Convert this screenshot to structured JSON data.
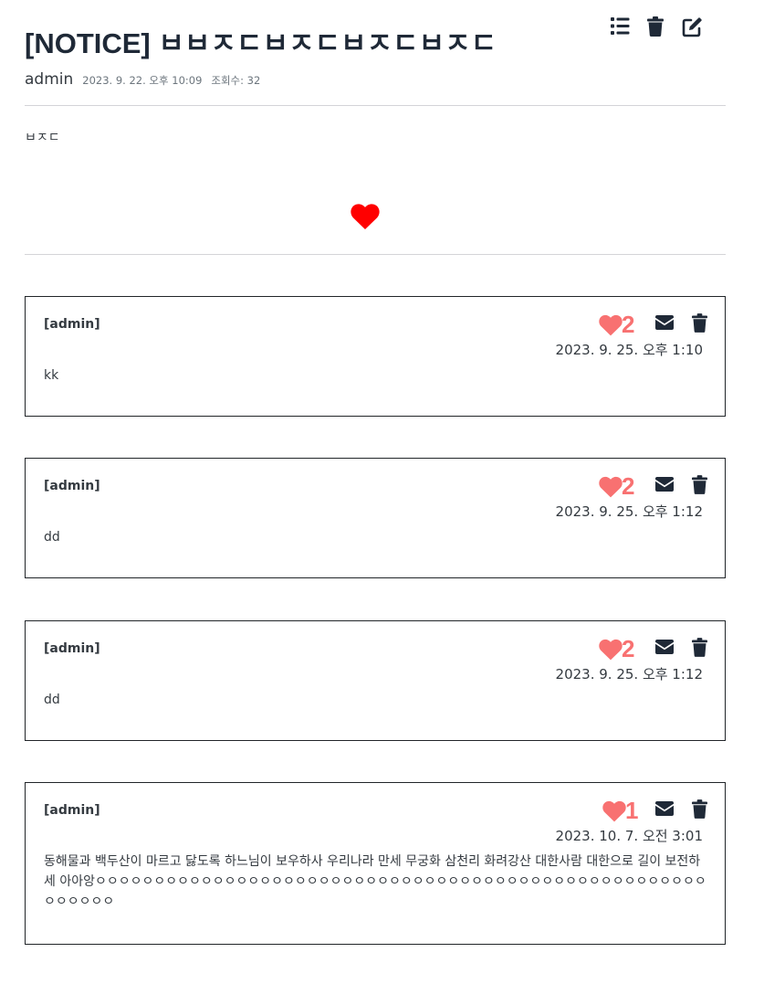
{
  "post": {
    "title": "[NOTICE] ㅂㅂㅈㄷㅂㅈㄷㅂㅈㄷㅂㅈㄷ",
    "author": "admin",
    "date": "2023. 9. 22. 오후 10:09",
    "views": "조회수: 32",
    "content": "ㅂㅈㄷ",
    "actions": [
      "list-icon",
      "trash-icon",
      "edit-icon"
    ],
    "like_icon": "heart-icon",
    "like_color": "#ff0000"
  },
  "comments": [
    {
      "author": "[admin]",
      "likes": "2",
      "date": "2023. 9. 25. 오후 1:10",
      "text": "kk"
    },
    {
      "author": "[admin]",
      "likes": "2",
      "date": "2023. 9. 25. 오후 1:12",
      "text": "dd"
    },
    {
      "author": "[admin]",
      "likes": "2",
      "date": "2023. 9. 25. 오후 1:12",
      "text": "dd"
    },
    {
      "author": "[admin]",
      "likes": "1",
      "date": "2023. 10. 7. 오전 3:01",
      "text": "동해물과 백두산이 마르고 닳도록 하느님이 보우하사 우리나라 만세 무궁화 삼천리 화려강산 대한사람 대한으로 길이 보전하세 아아앙ㅇㅇㅇㅇㅇㅇㅇㅇㅇㅇㅇㅇㅇㅇㅇㅇㅇㅇㅇㅇㅇㅇㅇㅇㅇㅇㅇㅇㅇㅇㅇㅇㅇㅇㅇㅇㅇㅇㅇㅇㅇㅇㅇㅇㅇㅇㅇㅇㅇㅇㅇㅇㅇㅇㅇㅇㅇㅇ"
    }
  ],
  "colors": {
    "comment_like": "#f87171",
    "icon": "#1f2937"
  }
}
